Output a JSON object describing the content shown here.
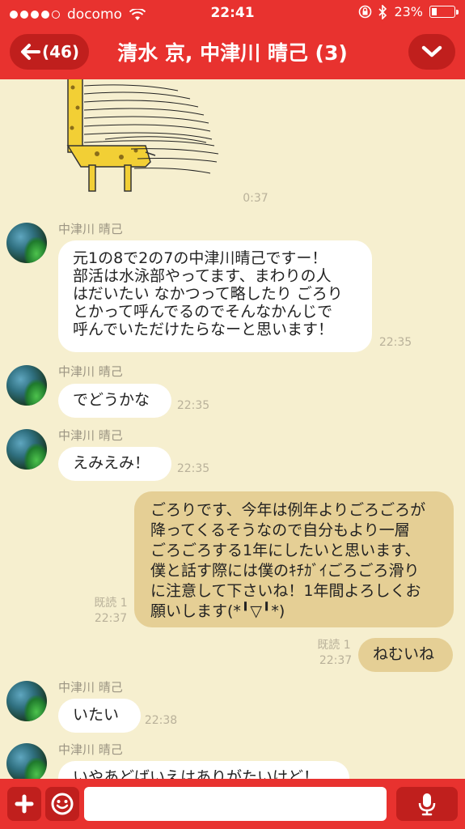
{
  "status_bar": {
    "carrier": "docomo",
    "time": "22:41",
    "battery": "23%",
    "battery_level": 0.23,
    "icons": [
      "signal-dots-icon",
      "wifi-icon",
      "rotation-lock-icon",
      "bluetooth-icon",
      "battery-icon"
    ]
  },
  "header": {
    "back_label": "(46)",
    "title": "清水 京, 中津川 晴己 (3)",
    "colors": {
      "bar": "#e8322f",
      "button": "#c01f1d"
    }
  },
  "messages": [
    {
      "type": "sticker",
      "time": "0:37",
      "icon": "giraffe-sticker"
    },
    {
      "sender": "中津川 晴己",
      "time": "22:35",
      "lines": [
        "元1の8で2の7の中津川晴己ですー！",
        "部活は水泳部やってます、まわりの人",
        "はだいたい なかつって略したり ごろり",
        "とかって呼んでるのでそんなかんじで",
        "呼んでいただけたらなーと思います！"
      ]
    },
    {
      "sender": "中津川 晴己",
      "time": "22:35",
      "lines": [
        "でどうかな"
      ]
    },
    {
      "sender": "中津川 晴己",
      "time": "22:35",
      "lines": [
        "えみえみ！"
      ]
    },
    {
      "mine": true,
      "read": "既読 1",
      "time": "22:37",
      "lines": [
        "ごろりです、今年は例年よりごろごろが",
        "降ってくるそうなので自分もより一層",
        "ごろごろする1年にしたいと思います、",
        "僕と話す際には僕のｷﾁｶﾞｲごろごろ滑り",
        "に注意して下さいね！1年間よろしくお",
        "願いします(*╹▽╹*)"
      ]
    },
    {
      "mine": true,
      "read": "既読 1",
      "time": "22:37",
      "lines": [
        "ねむいね"
      ]
    },
    {
      "sender": "中津川 晴己",
      "time": "22:38",
      "lines": [
        "いたい"
      ]
    },
    {
      "sender": "中津川 晴己",
      "lines": [
        "いやあどばいえはありがたいけど！"
      ]
    }
  ],
  "input_bar": {
    "placeholder": "",
    "buttons": [
      "plus-icon",
      "emoji-icon",
      "microphone-icon"
    ]
  }
}
